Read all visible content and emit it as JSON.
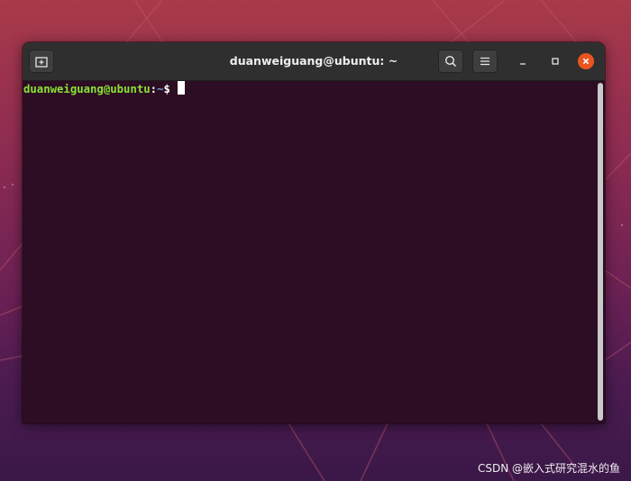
{
  "window": {
    "title": "duanweiguang@ubuntu: ~"
  },
  "titlebar": {
    "new_tab_icon": "new-tab-icon",
    "search_icon": "search-icon",
    "menu_icon": "hamburger-menu-icon",
    "minimize_icon": "minimize-icon",
    "maximize_icon": "maximize-icon",
    "close_icon": "close-icon"
  },
  "terminal": {
    "prompt_user_host": "duanweiguang@ubuntu",
    "prompt_separator": ":",
    "prompt_path": "~",
    "prompt_symbol": "$ "
  },
  "watermark": {
    "text": "CSDN @嵌入式研究混水的鱼"
  },
  "colors": {
    "desktop_top": "#a83a49",
    "desktop_bottom": "#3a1848",
    "terminal_bg": "#2c0d23",
    "titlebar_bg": "#2f2f2f",
    "prompt_user": "#8ae234",
    "prompt_path": "#729fcf",
    "close_button": "#e95420"
  }
}
